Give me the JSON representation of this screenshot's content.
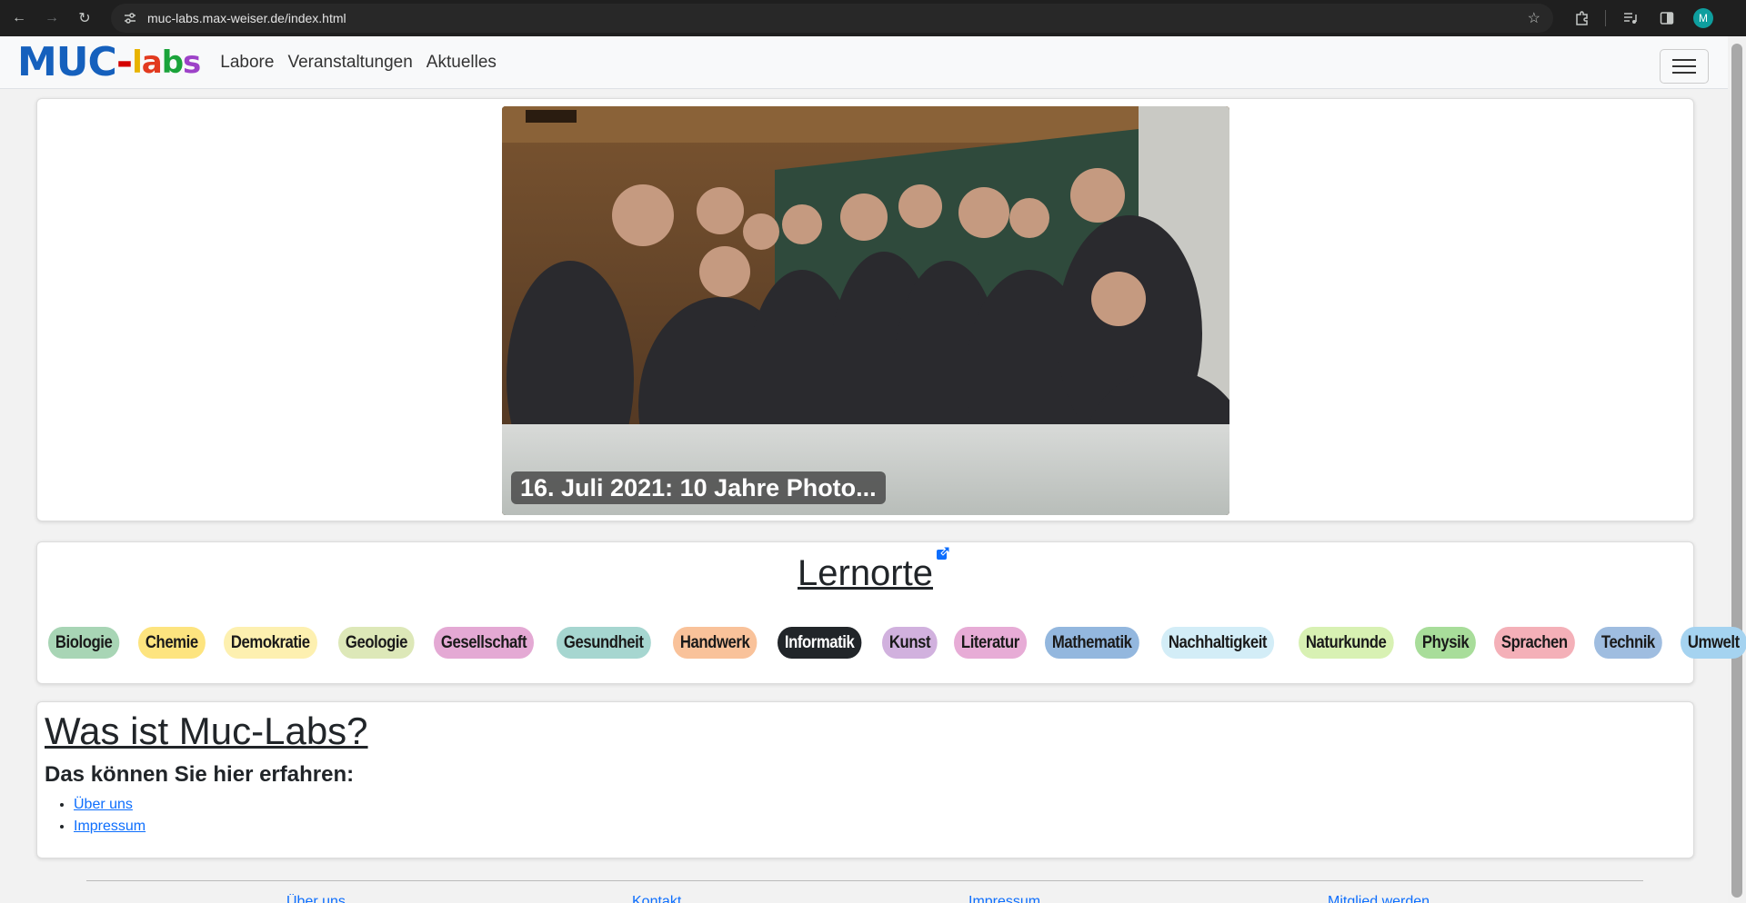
{
  "browser": {
    "url": "muc-labs.max-weiser.de/index.html",
    "avatar_letter": "M",
    "icons": [
      "back-icon",
      "forward-icon",
      "reload-icon",
      "site-info-icon",
      "star-icon",
      "extensions-icon",
      "media-icon",
      "side-panel-icon"
    ]
  },
  "site": {
    "logo": {
      "muc": "MUC",
      "dash": "-",
      "l": "l",
      "a": "a",
      "b": "b",
      "s": "s"
    },
    "nav": [
      "Labore",
      "Veranstaltungen",
      "Aktuelles"
    ],
    "colors": {
      "link": "#0d6efd",
      "navbar_bg": "#f8f9fa"
    }
  },
  "carousel": {
    "caption": "16. Juli 2021: 10 Jahre Photo..."
  },
  "lernorte": {
    "title": "Lernorte",
    "tags": [
      {
        "label": "Biologie",
        "color": "#a8d5b5"
      },
      {
        "label": "Chemie",
        "color": "#fde47f"
      },
      {
        "label": "Demokratie",
        "color": "#fdf0b0"
      },
      {
        "label": "Geologie",
        "color": "#dde8b8"
      },
      {
        "label": "Gesellschaft",
        "color": "#e4a9d4"
      },
      {
        "label": "Gesundheit",
        "color": "#a6d6d0"
      },
      {
        "label": "Handwerk",
        "color": "#f9c29a"
      },
      {
        "label": "Informatik",
        "color": "#212529",
        "text_color": "#ffffff"
      },
      {
        "label": "Kunst",
        "color": "#d1b1de"
      },
      {
        "label": "Literatur",
        "color": "#e7acd6"
      },
      {
        "label": "Mathematik",
        "color": "#93b7de"
      },
      {
        "label": "Nachhaltigkeit",
        "color": "#d3edf7"
      },
      {
        "label": "Naturkunde",
        "color": "#d8f1b3"
      },
      {
        "label": "Physik",
        "color": "#a8dd9a"
      },
      {
        "label": "Sprachen",
        "color": "#f4b0b8"
      },
      {
        "label": "Technik",
        "color": "#9fbde0"
      },
      {
        "label": "Umwelt",
        "color": "#a5d3f0"
      }
    ]
  },
  "about": {
    "title": "Was ist Muc-Labs?",
    "subtitle": "Das können Sie hier erfahren:",
    "links": [
      "Über uns",
      "Impressum"
    ]
  },
  "footer": {
    "links": [
      "Über uns",
      "Kontakt",
      "Impressum",
      "Mitglied werden"
    ]
  }
}
